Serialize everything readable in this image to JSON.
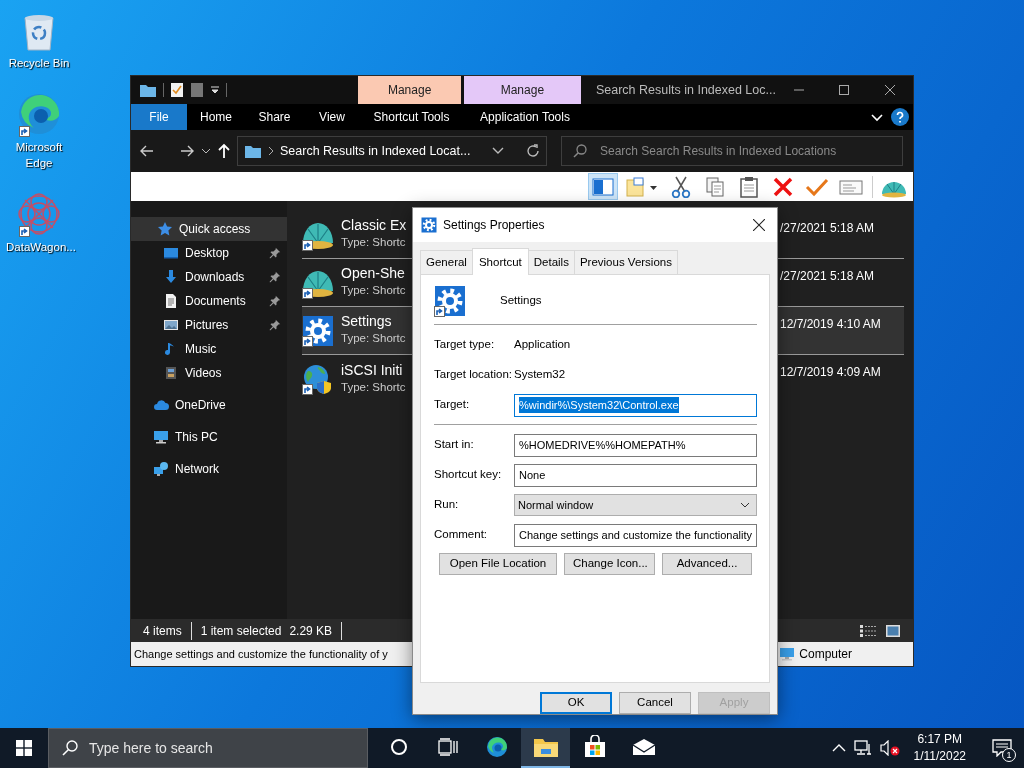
{
  "desktop_icons": [
    {
      "label": "Recycle Bin",
      "kind": "recycle",
      "shortcut": false
    },
    {
      "label": "Microsoft Edge",
      "kind": "browser",
      "shortcut": true
    },
    {
      "label": "DataWagon...",
      "kind": "pattern",
      "shortcut": true
    }
  ],
  "explorer": {
    "title": "Search Results in Indexed Loc...",
    "ribbon_tabs": [
      {
        "label": "File",
        "kind": "file",
        "selected": false
      },
      {
        "label": "Home",
        "kind": "plain",
        "selected": false
      },
      {
        "label": "Share",
        "kind": "plain",
        "selected": false
      },
      {
        "label": "View",
        "kind": "plain",
        "selected": false
      },
      {
        "label": "Shortcut Tools",
        "kind": "context",
        "group": "Manage",
        "color": "#fbc9b2",
        "selected": false
      },
      {
        "label": "Application Tools",
        "kind": "context",
        "group": "Manage",
        "color": "#e4c8f8",
        "selected": false
      }
    ],
    "address": "Search Results in Indexed Locat...",
    "search": {
      "placeholder": "Search Search Results in Indexed Locations"
    },
    "toolbar": [
      {
        "kind": "pane",
        "pressed": true
      },
      {
        "kind": "newitem",
        "pressed": false
      },
      {
        "kind": "cut",
        "pressed": false
      },
      {
        "kind": "copy",
        "pressed": false
      },
      {
        "kind": "paste",
        "pressed": false
      },
      {
        "kind": "delete",
        "pressed": false
      },
      {
        "kind": "check",
        "pressed": false
      },
      {
        "kind": "card",
        "pressed": false
      },
      {
        "kind": "shell",
        "pressed": false
      }
    ],
    "nav": [
      {
        "label": "Quick access",
        "kind": "star",
        "selected": true,
        "children": [
          {
            "label": "Desktop",
            "kind": "desktop",
            "pinned": true,
            "selected": false
          },
          {
            "label": "Downloads",
            "kind": "downloads",
            "pinned": true,
            "selected": false
          },
          {
            "label": "Documents",
            "kind": "documents",
            "pinned": true,
            "selected": false
          },
          {
            "label": "Pictures",
            "kind": "pictures",
            "pinned": true,
            "selected": false
          },
          {
            "label": "Music",
            "kind": "music",
            "pinned": false,
            "selected": false
          },
          {
            "label": "Videos",
            "kind": "videos",
            "pinned": false,
            "selected": false
          }
        ]
      },
      {
        "label": "OneDrive",
        "kind": "cloud",
        "selected": false
      },
      {
        "label": "This PC",
        "kind": "pc",
        "selected": false
      },
      {
        "label": "Network",
        "kind": "network",
        "selected": false
      }
    ],
    "files": [
      {
        "name": "Classic Ex",
        "type": "Type: Shortc",
        "date": "/27/2021 5:18 AM",
        "kind": "shell",
        "selected": false
      },
      {
        "name": "Open-She",
        "type": "Type: Shortc",
        "date": "/27/2021 5:18 AM",
        "kind": "shell",
        "selected": false
      },
      {
        "name": "Settings",
        "type": "Type: Shortc",
        "date": "12/7/2019 4:10 AM",
        "kind": "gear",
        "selected": true
      },
      {
        "name": "iSCSI Initi",
        "type": "Type: Shortc",
        "date": "12/7/2019 4:09 AM",
        "kind": "globe",
        "selected": false
      }
    ],
    "status": [
      {
        "text": "4 items",
        "divider": true
      },
      {
        "text": "1 item selected",
        "divider": false
      },
      {
        "text": "2.29 KB",
        "divider": true
      }
    ],
    "details_text": "Change settings and customize the functionality of y",
    "location": "Computer"
  },
  "dialog": {
    "title": "Settings Properties",
    "tabs": [
      {
        "label": "General",
        "selected": false
      },
      {
        "label": "Shortcut",
        "selected": true
      },
      {
        "label": "Details",
        "selected": false
      },
      {
        "label": "Previous Versions",
        "selected": false
      }
    ],
    "name": "Settings",
    "sections": [
      {
        "fields": [
          {
            "label": "Target type:",
            "kind": "text",
            "value": "Application"
          },
          {
            "label": "Target location:",
            "kind": "text",
            "value": "System32"
          },
          {
            "label": "Target:",
            "kind": "input",
            "value": "%windir%\\System32\\Control.exe",
            "highlighted": true
          }
        ]
      },
      {
        "fields": [
          {
            "label": "Start in:",
            "kind": "input",
            "value": "%HOMEDRIVE%%HOMEPATH%",
            "highlighted": false
          },
          {
            "label": "Shortcut key:",
            "kind": "input",
            "value": "None",
            "highlighted": false
          },
          {
            "label": "Run:",
            "kind": "select",
            "value": "Normal window"
          },
          {
            "label": "Comment:",
            "kind": "input",
            "value": "Change settings and customize the functionality",
            "highlighted": false
          }
        ]
      }
    ],
    "actions": [
      "Open File Location",
      "Change Icon...",
      "Advanced..."
    ],
    "buttons": [
      {
        "label": "OK",
        "default": true,
        "disabled": false
      },
      {
        "label": "Cancel",
        "default": false,
        "disabled": false
      },
      {
        "label": "Apply",
        "default": false,
        "disabled": true
      }
    ]
  },
  "taskbar": {
    "search": {
      "placeholder": "Type here to search"
    },
    "apps": [
      {
        "kind": "cortana",
        "active": false
      },
      {
        "kind": "taskview",
        "active": false
      },
      {
        "kind": "browser",
        "active": false
      },
      {
        "kind": "folder",
        "active": true
      },
      {
        "kind": "store",
        "active": false
      },
      {
        "kind": "mail",
        "active": false
      }
    ],
    "time": "6:17 PM",
    "date": "1/11/2022",
    "notifications": "1"
  }
}
